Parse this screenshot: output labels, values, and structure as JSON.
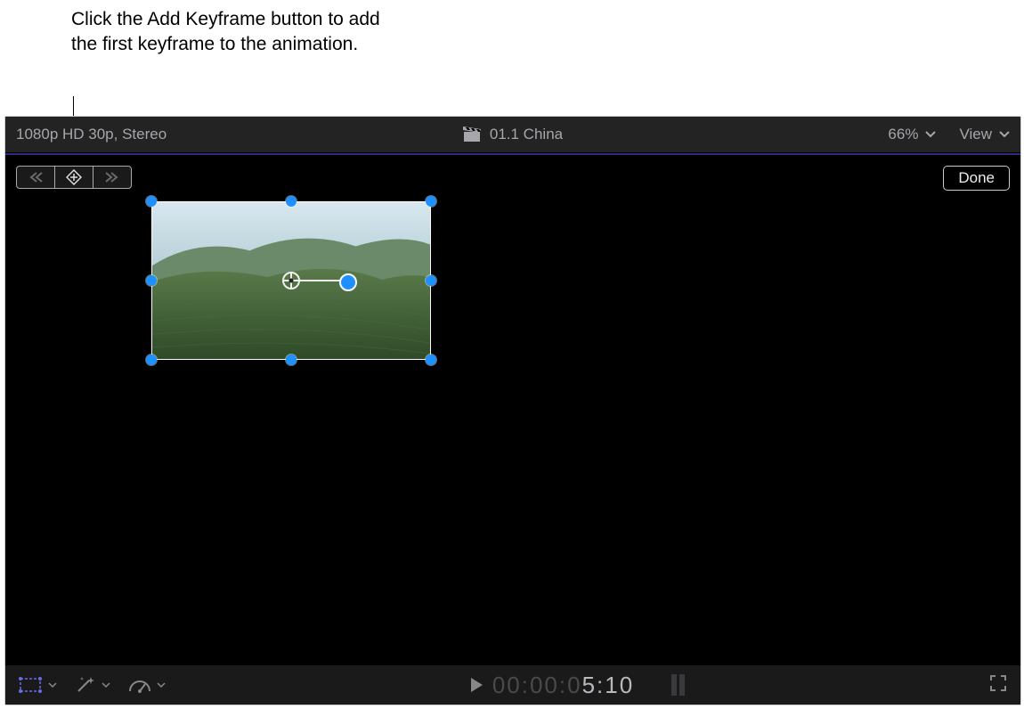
{
  "callout": {
    "text": "Click the Add Keyframe button to add the first keyframe to the animation."
  },
  "title_bar": {
    "format_label": "1080p HD 30p, Stereo",
    "clip_title": "01.1 China",
    "zoom_label": "66%",
    "view_label": "View"
  },
  "overlay": {
    "done_label": "Done"
  },
  "icons": {
    "prev_keyframe": "prev-keyframe-icon",
    "add_keyframe": "add-keyframe-icon",
    "next_keyframe": "next-keyframe-icon",
    "clapboard": "clapboard-icon",
    "transform_tool": "transform-tool-icon",
    "effects_tool": "effects-wand-icon",
    "retime_tool": "retime-gauge-icon",
    "play": "play-icon",
    "fullscreen": "fullscreen-icon"
  },
  "timecode": {
    "dim": "00:00:0",
    "bright": "5:10"
  }
}
